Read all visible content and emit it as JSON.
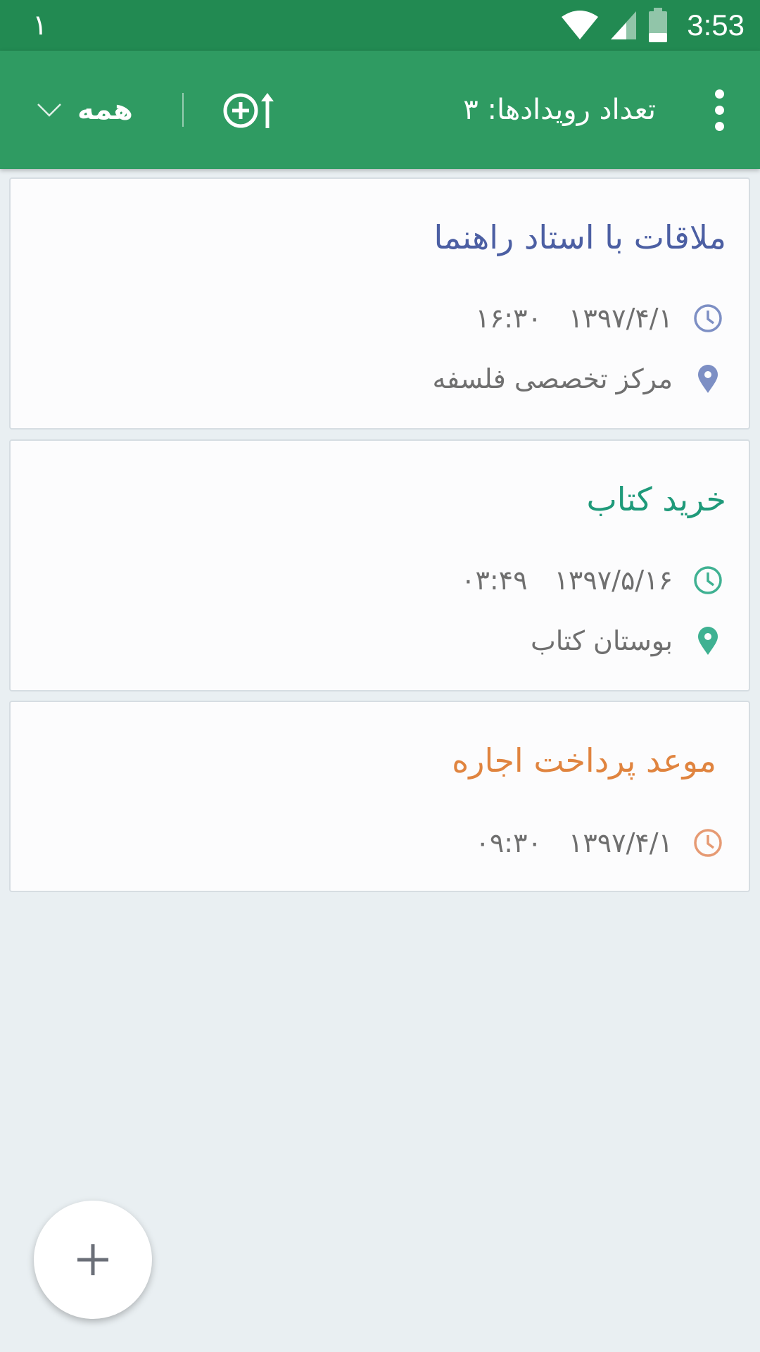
{
  "status_bar": {
    "notification_count": "١",
    "time": "3:53",
    "icons": [
      "wifi-icon",
      "cell-signal-icon",
      "battery-icon"
    ]
  },
  "app_bar": {
    "filter_label": "همه",
    "event_count": "تعداد رویدادها: ۳",
    "icons": [
      "chevron-down-icon",
      "add-sort-icon",
      "more-vert-icon"
    ]
  },
  "events": [
    {
      "title": "ملاقات با استاد راهنما",
      "time": "۱۶:۳۰",
      "date": "۱۳۹۷/۴/۱",
      "location": "مرکز تخصصی فلسفه",
      "color": "#4c5fa3",
      "icon_color": "#7d8fc4"
    },
    {
      "title": "خرید کتاب",
      "time": "۰۳:۴۹",
      "date": "۱۳۹۷/۵/۱۶",
      "location": "بوستان کتاب",
      "color": "#1f9a7a",
      "icon_color": "#3fb192"
    },
    {
      "title": "موعد پرداخت اجاره",
      "time": "۰۹:۳۰",
      "date": "۱۳۹۷/۴/۱",
      "color": "#e0843f",
      "icon_color": "#e69a73"
    }
  ],
  "fab": {
    "icon": "plus-icon"
  }
}
